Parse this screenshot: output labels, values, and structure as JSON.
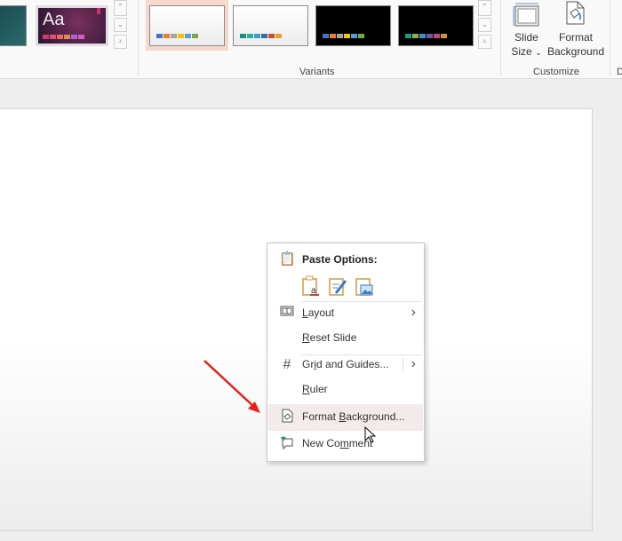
{
  "ribbon": {
    "theme_sample_text": "Aa",
    "variants_label": "Variants",
    "customize_label": "Customize",
    "next_group_initial": "D",
    "slide_size": {
      "line1": "Slide",
      "line2": "Size",
      "chevron": "⌄"
    },
    "format_background": {
      "line1": "Format",
      "line2": "Background"
    },
    "variants": [
      {
        "bg": "#f4f4f4",
        "swatches": [
          "#4472c4",
          "#ed7d31",
          "#a5a5a5",
          "#ffc000",
          "#5b9bd5",
          "#70ad47"
        ],
        "selected": true
      },
      {
        "bg": "#f4f4f4",
        "swatches": [
          "#1e8c7a",
          "#2bb0a0",
          "#3aa0c8",
          "#2e6fb0",
          "#c8502a",
          "#e8a030"
        ],
        "selected": false
      },
      {
        "bg": "#000000",
        "swatches": [
          "#4472c4",
          "#ed7d31",
          "#a5a5a5",
          "#ffc000",
          "#5b9bd5",
          "#70ad47"
        ],
        "selected": false
      },
      {
        "bg": "#000000",
        "swatches": [
          "#1e9c80",
          "#8cb050",
          "#3a90c0",
          "#7058a0",
          "#c04878",
          "#d09040"
        ],
        "selected": false
      }
    ]
  },
  "context_menu": {
    "paste_options_label": "Paste Options:",
    "items": [
      {
        "name": "layout",
        "pre": "",
        "key": "L",
        "post": "ayout",
        "icon": "layout-icon",
        "submenu": true
      },
      {
        "name": "reset-slide",
        "pre": "",
        "key": "R",
        "post": "eset Slide",
        "icon": "",
        "submenu": false
      },
      {
        "name": "grid-and-guides",
        "pre": "Gr",
        "key": "i",
        "post": "d and Guides...",
        "icon": "grid-icon",
        "submenu": true
      },
      {
        "name": "ruler",
        "pre": "",
        "key": "R",
        "post": "uler",
        "icon": "",
        "submenu": false
      },
      {
        "name": "format-background",
        "pre": "Format ",
        "key": "B",
        "post": "ackground...",
        "icon": "format-background-icon",
        "submenu": false,
        "highlighted": true
      },
      {
        "name": "new-comment",
        "pre": "New Co",
        "key": "m",
        "post": "ment",
        "icon": "new-comment-icon",
        "submenu": false
      }
    ]
  },
  "colors": {
    "arrow": "#e8201c",
    "highlight": "#f3eaea",
    "selected_variant": "#f6d9cc"
  }
}
